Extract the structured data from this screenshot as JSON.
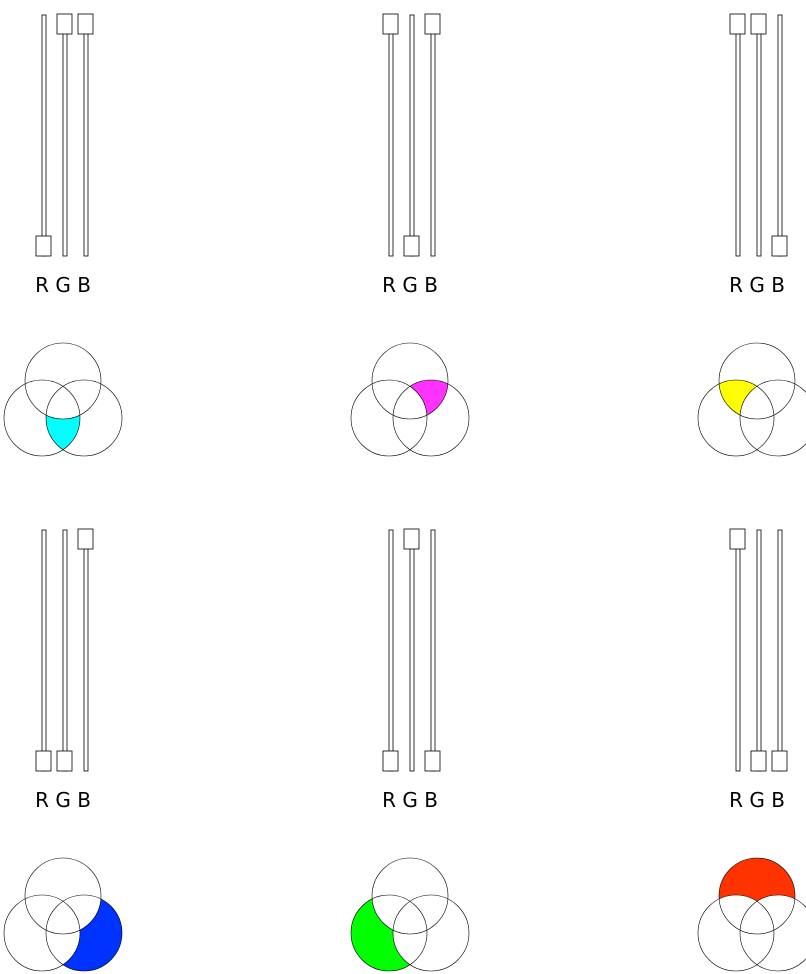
{
  "channel_labels": [
    "R",
    "G",
    "B"
  ],
  "panels": [
    {
      "handles": [
        "bottom",
        "top",
        "top"
      ],
      "region": "gb",
      "fill": "#00ffff",
      "title": "R G B"
    },
    {
      "handles": [
        "top",
        "bottom",
        "top"
      ],
      "region": "rb",
      "fill": "#ff33ff",
      "title": "R G B"
    },
    {
      "handles": [
        "top",
        "top",
        "bottom"
      ],
      "region": "rg",
      "fill": "#ffff00",
      "title": "R G B"
    },
    {
      "handles": [
        "bottom",
        "bottom",
        "top"
      ],
      "region": "b_only",
      "fill": "#0033ff",
      "title": "R G B"
    },
    {
      "handles": [
        "bottom",
        "top",
        "bottom"
      ],
      "region": "g_only",
      "fill": "#00ff00",
      "title": "R G B"
    },
    {
      "handles": [
        "top",
        "bottom",
        "bottom"
      ],
      "region": "r_only",
      "fill": "#ff3300",
      "title": "R G B"
    }
  ]
}
